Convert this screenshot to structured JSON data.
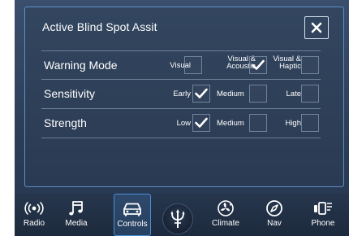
{
  "panel": {
    "title": "Active Blind Spot Assit"
  },
  "rows": [
    {
      "label": "Warning Mode",
      "options": [
        {
          "label": "Visual",
          "checked": false
        },
        {
          "label_line1": "Visual &",
          "label_line2": "Acoustic",
          "checked": true
        },
        {
          "label_line1": "Visual &",
          "label_line2": "Haptic",
          "checked": false
        }
      ]
    },
    {
      "label": "Sensitivity",
      "options": [
        {
          "label": "Early",
          "checked": true
        },
        {
          "label": "Medium",
          "checked": false
        },
        {
          "label": "Late",
          "checked": false
        }
      ]
    },
    {
      "label": "Strength",
      "options": [
        {
          "label": "Low",
          "checked": true
        },
        {
          "label": "Medium",
          "checked": false
        },
        {
          "label": "High",
          "checked": false
        }
      ]
    }
  ],
  "nav": {
    "items": [
      {
        "label": "Radio",
        "icon": "radio-icon"
      },
      {
        "label": "Media",
        "icon": "music-note-icon"
      },
      {
        "label": "Controls",
        "icon": "car-icon",
        "active": true
      },
      {
        "label": "",
        "icon": "trident-logo-icon"
      },
      {
        "label": "Climate",
        "icon": "fan-icon"
      },
      {
        "label": "Nav",
        "icon": "compass-icon"
      },
      {
        "label": "Phone",
        "icon": "phone-icon"
      }
    ]
  },
  "colors": {
    "accent": "#4b8ed8",
    "panel_border": "#5d8fc9",
    "background": "#2c3d57"
  }
}
